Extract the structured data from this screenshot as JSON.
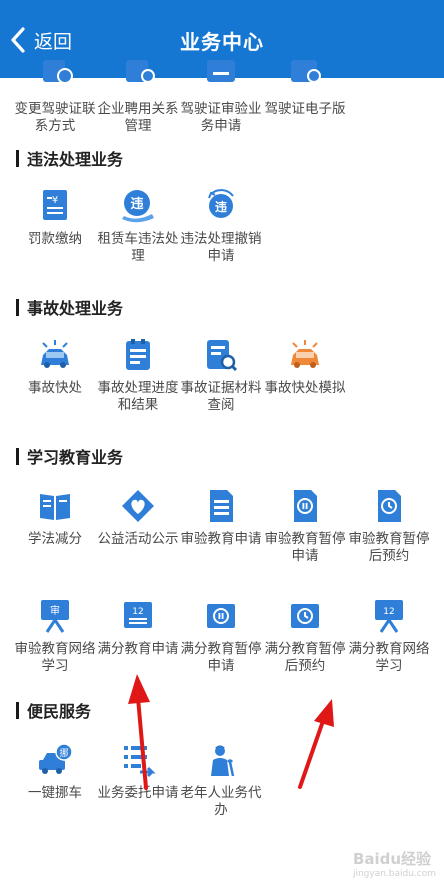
{
  "nav": {
    "back_label": "返回",
    "title": "业务中心"
  },
  "top_row": [
    {
      "label": "变更驾驶证联系方式",
      "icon": "phone-edit-icon"
    },
    {
      "label": "企业聘用关系管理",
      "icon": "settings-doc-icon"
    },
    {
      "label": "驾驶证审验业务申请",
      "icon": "license-review-icon"
    },
    {
      "label": "驾驶证电子版",
      "icon": "e-license-icon"
    }
  ],
  "sections": [
    {
      "title": "违法处理业务",
      "items": [
        {
          "label": "罚款缴纳",
          "icon": "fine-payment-icon"
        },
        {
          "label": "租赁车违法处理",
          "icon": "rental-violation-icon"
        },
        {
          "label": "违法处理撤销申请",
          "icon": "violation-cancel-icon"
        }
      ]
    },
    {
      "title": "事故处理业务",
      "items": [
        {
          "label": "事故快处",
          "icon": "accident-quick-icon"
        },
        {
          "label": "事故处理进度和结果",
          "icon": "accident-progress-icon"
        },
        {
          "label": "事故证据材料查阅",
          "icon": "evidence-search-icon"
        },
        {
          "label": "事故快处模拟",
          "icon": "accident-sim-icon"
        }
      ]
    },
    {
      "title": "学习教育业务",
      "items": [
        {
          "label": "学法减分",
          "icon": "book-icon"
        },
        {
          "label": "公益活动公示",
          "icon": "charity-heart-icon"
        },
        {
          "label": "审验教育申请",
          "icon": "document-icon"
        },
        {
          "label": "审验教育暂停申请",
          "icon": "pause-doc-icon"
        },
        {
          "label": "审验教育暂停后预约",
          "icon": "clock-doc-icon"
        },
        {
          "label": "审验教育网络学习",
          "icon": "online-board-icon",
          "badge": "审"
        },
        {
          "label": "满分教育申请",
          "icon": "score-doc-icon",
          "badge": "12"
        },
        {
          "label": "满分教育暂停申请",
          "icon": "pause-card-icon"
        },
        {
          "label": "满分教育暂停后预约",
          "icon": "clock-card-icon"
        },
        {
          "label": "满分教育网络学习",
          "icon": "online-board-icon",
          "badge": "12"
        }
      ]
    },
    {
      "title": "便民服务",
      "items": [
        {
          "label": "一键挪车",
          "icon": "move-car-icon",
          "badge": "挪"
        },
        {
          "label": "业务委托申请",
          "icon": "delegate-list-icon"
        },
        {
          "label": "老年人业务代办",
          "icon": "elderly-icon"
        }
      ]
    }
  ],
  "watermark": {
    "text": "Baidu经验",
    "sub": "jingyan.baidu.com"
  },
  "colors": {
    "nav": "#1677d2",
    "icon": "#2f7fd8",
    "orange": "#f0883a",
    "arrow": "#e01717"
  }
}
